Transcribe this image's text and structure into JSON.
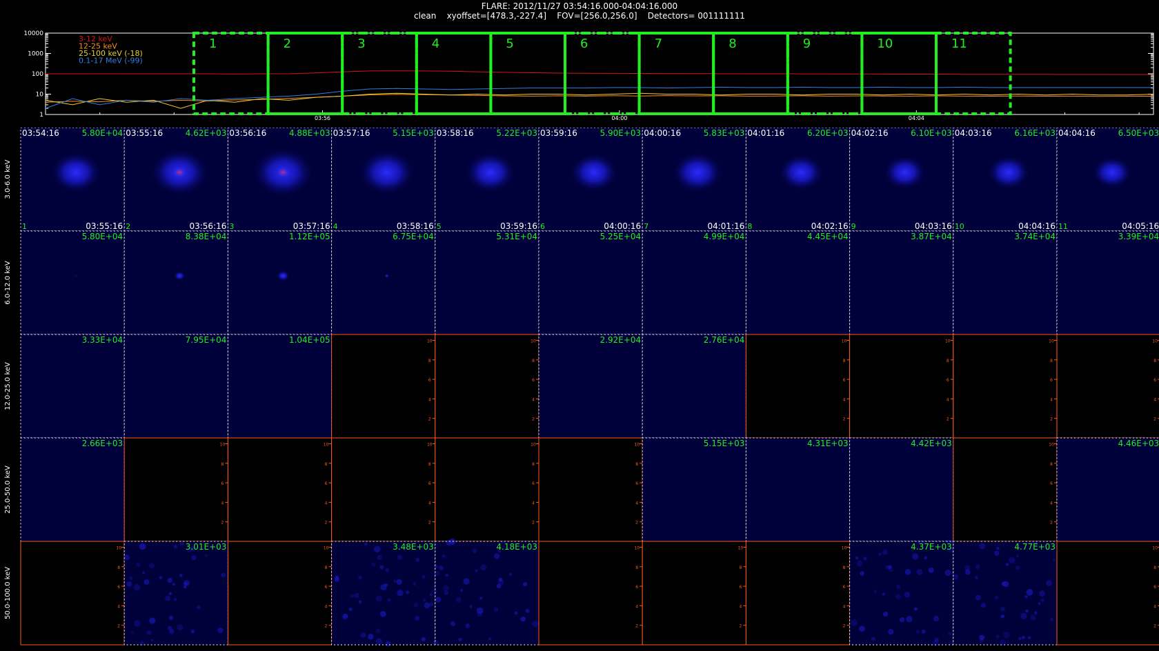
{
  "header": {
    "line1": "FLARE: 2012/11/27 03:54:16.000-04:04:16.000",
    "line2": "clean    xyoffset=[478.3,-227.4]    FOV=[256.0,256.0]    Detectors= 001111111"
  },
  "colors": {
    "background": "#000000",
    "curve_3_12": "#d01818",
    "curve_12_25": "#ff8c1a",
    "curve_25_100": "#e8d030",
    "curve_01_17": "#2f7fe6",
    "interval_box": "#22ee22",
    "tile_label": "#22ee22",
    "empty_axis": "#ff5a1a",
    "image_blue": "#1a1aee"
  },
  "chart_data": [
    {
      "type": "line",
      "ylim": [
        1,
        10000
      ],
      "yscale": "log",
      "y_tick_labels": [
        "10000",
        "1000",
        "100",
        "10",
        "1"
      ],
      "x_tick_labels": [
        "03:56",
        "04:00",
        "04:04"
      ],
      "legend_placement": "top-left",
      "series": [
        {
          "name": "3-12 keV",
          "color_key": "curve_3_12",
          "values": [
            100,
            100,
            101,
            100,
            100,
            100,
            100,
            98,
            100,
            101,
            110,
            125,
            138,
            140,
            138,
            135,
            125,
            118,
            112,
            108,
            106,
            105,
            104,
            103,
            102,
            101,
            100,
            100,
            99,
            99,
            98,
            97,
            96,
            96,
            95,
            95,
            94,
            94,
            93,
            93,
            92,
            92
          ]
        },
        {
          "name": "12-25 keV",
          "color_key": "curve_12_25",
          "values": [
            4,
            4.5,
            4.2,
            5,
            4.4,
            5,
            4.6,
            5.2,
            5.5,
            6.2,
            7,
            8,
            9.2,
            9.8,
            9.5,
            9,
            8.6,
            8.2,
            8,
            8.3,
            8,
            8.4,
            8.1,
            8.5,
            8.2,
            8.3,
            8,
            8.1,
            8.3,
            8,
            8.2,
            8.1,
            8,
            8.2,
            8,
            7.9,
            8.1,
            7.9,
            8,
            7.8,
            7.9,
            7.9
          ]
        },
        {
          "name": "25-100 keV (-18)",
          "color_key": "curve_25_100",
          "values": [
            5,
            3,
            6,
            4,
            5,
            2,
            5,
            4,
            6,
            5,
            7,
            8,
            10,
            11,
            10,
            9,
            10,
            9,
            10,
            10,
            9,
            10,
            11,
            10,
            10,
            9,
            10,
            10,
            9,
            10,
            10,
            9,
            10,
            9,
            10,
            9,
            10,
            9,
            10,
            9,
            9,
            10
          ]
        },
        {
          "name": "0.1-17 MeV (-99)",
          "color_key": "curve_01_17",
          "values": [
            2,
            6,
            3,
            5,
            4,
            6,
            5,
            6,
            7,
            8,
            10,
            14,
            18,
            19,
            18,
            17,
            18,
            19,
            20,
            20,
            20,
            21,
            21,
            20,
            21,
            22,
            21,
            21,
            22,
            21,
            21,
            22,
            21,
            21,
            22,
            21,
            21,
            21,
            21,
            21,
            21,
            21
          ]
        }
      ],
      "intervals": [
        {
          "label": "1",
          "start": "03:54:16",
          "end": "03:55:16"
        },
        {
          "label": "2",
          "start": "03:55:16",
          "end": "03:56:16"
        },
        {
          "label": "3",
          "start": "03:56:16",
          "end": "03:57:16"
        },
        {
          "label": "4",
          "start": "03:57:16",
          "end": "03:58:16"
        },
        {
          "label": "5",
          "start": "03:58:16",
          "end": "03:59:16"
        },
        {
          "label": "6",
          "start": "03:59:16",
          "end": "04:00:16"
        },
        {
          "label": "7",
          "start": "04:00:16",
          "end": "04:01:16"
        },
        {
          "label": "8",
          "start": "04:01:16",
          "end": "04:02:16"
        },
        {
          "label": "9",
          "start": "04:02:16",
          "end": "04:03:16"
        },
        {
          "label": "10",
          "start": "04:03:16",
          "end": "04:04:16"
        },
        {
          "label": "11",
          "start": "04:04:16",
          "end": "04:05:16"
        }
      ]
    },
    {
      "type": "heatmap",
      "energy_bands": [
        "3.0-6.0 keV",
        "6.0-12.0 keV",
        "12.0-25.0 keV",
        "25.0-50.0 keV",
        "50.0-100.0 keV"
      ],
      "columns": [
        {
          "start": "03:54:16",
          "end": "03:55:16",
          "index": "1"
        },
        {
          "start": "03:55:16",
          "end": "03:56:16",
          "index": "2"
        },
        {
          "start": "03:56:16",
          "end": "03:57:16",
          "index": "3"
        },
        {
          "start": "03:57:16",
          "end": "03:58:16",
          "index": "4"
        },
        {
          "start": "03:58:16",
          "end": "03:59:16",
          "index": "5"
        },
        {
          "start": "03:59:16",
          "end": "04:00:16",
          "index": "6"
        },
        {
          "start": "04:00:16",
          "end": "04:01:16",
          "index": "7"
        },
        {
          "start": "04:01:16",
          "end": "04:02:16",
          "index": "8"
        },
        {
          "start": "04:02:16",
          "end": "04:03:16",
          "index": "9"
        },
        {
          "start": "04:03:16",
          "end": "04:04:16",
          "index": "10"
        },
        {
          "start": "04:04:16",
          "end": "04:05:16",
          "index": "11"
        }
      ],
      "peaks": [
        [
          "5.80E+04",
          "4.62E+03",
          "4.88E+03",
          "5.15E+03",
          "5.22E+03",
          "5.90E+03",
          "5.83E+03",
          "6.20E+03",
          "6.10E+03",
          "6.16E+03",
          "6.50E+03"
        ],
        [
          "5.80E+04",
          "8.38E+04",
          "1.12E+05",
          "6.75E+04",
          "5.31E+04",
          "5.25E+04",
          "4.99E+04",
          "4.45E+04",
          "3.87E+04",
          "3.74E+04",
          "3.39E+04"
        ],
        [
          "3.33E+04",
          "7.95E+04",
          "1.04E+05",
          "",
          "",
          "2.92E+04",
          "2.76E+04",
          "",
          "",
          "",
          ""
        ],
        [
          "2.66E+03",
          "",
          "",
          "",
          "",
          "",
          "5.15E+03",
          "4.31E+03",
          "4.42E+03",
          "",
          "4.46E+03"
        ],
        [
          "",
          "3.01E+03",
          "",
          "3.48E+03",
          "4.18E+03",
          "",
          "",
          "",
          "4.37E+03",
          "4.77E+03",
          ""
        ]
      ],
      "source_intensity": [
        [
          0.7,
          0.85,
          0.9,
          0.8,
          0.7,
          0.65,
          0.7,
          0.6,
          0.55,
          0.55,
          0.5
        ],
        [
          0.1,
          0.6,
          0.7,
          0.25,
          0.0,
          0.0,
          0.0,
          0.0,
          0.0,
          0.0,
          0.0
        ],
        [
          0,
          0,
          0,
          0,
          0,
          0,
          0,
          0,
          0,
          0,
          0
        ],
        [
          0,
          0,
          0,
          0,
          0,
          0,
          0,
          0,
          0,
          0,
          0
        ],
        [
          0,
          0.2,
          0,
          0.2,
          0.25,
          0,
          0,
          0,
          0.2,
          0.2,
          0
        ]
      ],
      "empty_axis_tick_labels": [
        "2",
        "4",
        "6",
        "8",
        "10"
      ]
    }
  ]
}
